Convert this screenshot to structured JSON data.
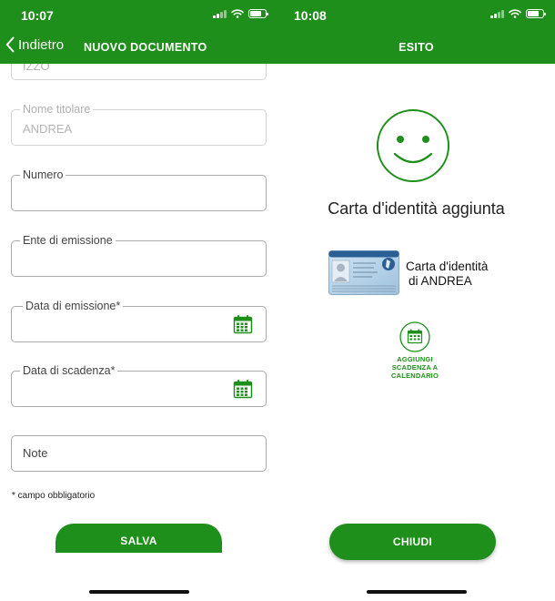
{
  "left": {
    "status": {
      "time": "10:07"
    },
    "nav": {
      "back_label": "Indietro",
      "title": "NUOVO DOCUMENTO"
    },
    "form": {
      "partial_field_value": "IZZO",
      "fields": [
        {
          "label": "Nome titolare",
          "value": "ANDREA"
        },
        {
          "label": "Numero",
          "value": ""
        },
        {
          "label": "Ente di emissione",
          "value": ""
        },
        {
          "label": "Data di emissione*",
          "value": ""
        },
        {
          "label": "Data di scadenza*",
          "value": ""
        }
      ],
      "notes_placeholder": "Note",
      "required_note": "* campo obbligatorio",
      "save_label": "SALVA"
    }
  },
  "right": {
    "status": {
      "time": "10:08"
    },
    "nav": {
      "title": "ESITO"
    },
    "result": {
      "message": "Carta d'identità aggiunta",
      "card_line1": "Carta d'identità",
      "card_line2": "di ANDREA",
      "calendar_line1": "AGGIUNGI",
      "calendar_line2": "SCADENZA A",
      "calendar_line3": "CALENDARIO",
      "close_label": "CHIUDI"
    }
  },
  "colors": {
    "accent": "#1e8f1a",
    "text": "#222222",
    "border": "#a9a9a9"
  },
  "icons": [
    "back-chevron-icon",
    "calendar-icon",
    "smiley-icon",
    "id-card-icon",
    "signal-icon",
    "wifi-icon",
    "battery-icon"
  ]
}
